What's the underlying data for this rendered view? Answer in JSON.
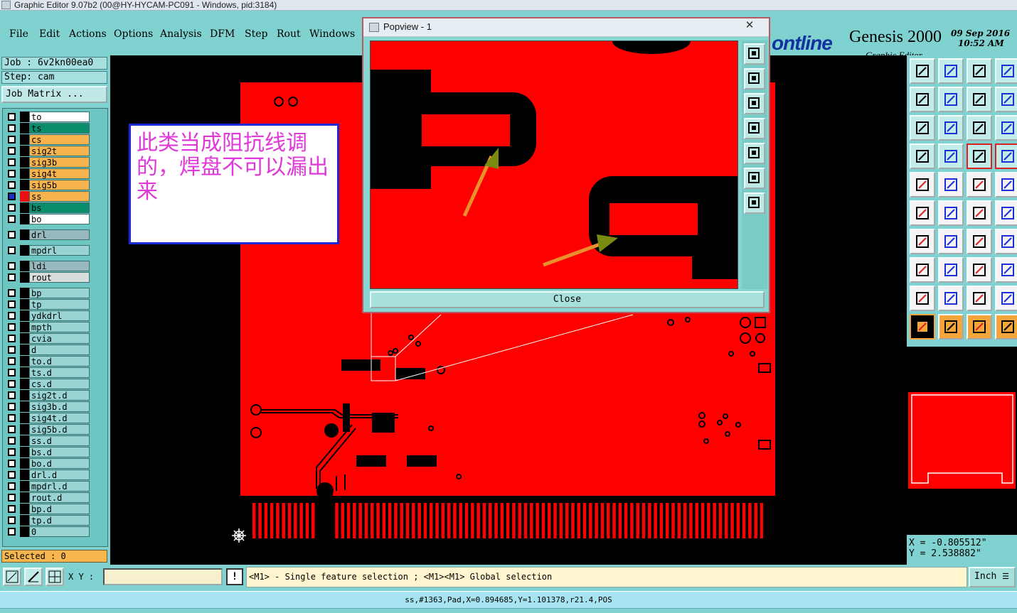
{
  "window": {
    "title": "Graphic Editor 9.07b2 (00@HY-HYCAM-PC091 - Windows, pid:3184)"
  },
  "menu": [
    {
      "label": "File"
    },
    {
      "label": "Edit"
    },
    {
      "label": "Actions"
    },
    {
      "label": "Options"
    },
    {
      "label": "Analysis"
    },
    {
      "label": "DFM"
    },
    {
      "label": "Step"
    },
    {
      "label": "Rout"
    },
    {
      "label": "Windows"
    }
  ],
  "brand": {
    "logo": "ontline",
    "product": "Genesis 2000",
    "subtitle": "Graphic Editor",
    "date_line1": "09 Sep 2016",
    "date_line2": "10:52 AM",
    "pause_glyph": "II"
  },
  "job": {
    "job_label": "Job : 6v2kn00ea0",
    "step_label": "Step: cam",
    "matrix_button": "Job Matrix ..."
  },
  "layers": [
    {
      "name": "to",
      "color": "#ffffff"
    },
    {
      "name": "ts",
      "color": "#0a8d6a"
    },
    {
      "name": "cs",
      "color": "#f6b34e"
    },
    {
      "name": "sig2t",
      "color": "#f6b34e"
    },
    {
      "name": "sig3b",
      "color": "#f6b34e"
    },
    {
      "name": "sig4t",
      "color": "#f6b34e"
    },
    {
      "name": "sig5b",
      "color": "#f6b34e"
    },
    {
      "name": "ss",
      "color": "#f6b34e",
      "active": true
    },
    {
      "name": "bs",
      "color": "#0a8d6a"
    },
    {
      "name": "bo",
      "color": "#ffffff"
    },
    {
      "name": "drl",
      "color": "#98b8bf"
    },
    {
      "name": "mpdrl",
      "color": "#98d4d4"
    },
    {
      "name": "ldi",
      "color": "#98b8bf"
    },
    {
      "name": "rout",
      "color": "#d8dede"
    },
    {
      "name": "bp",
      "color": "#98d4d4"
    },
    {
      "name": "tp",
      "color": "#98d4d4"
    },
    {
      "name": "ydkdrl",
      "color": "#98d4d4"
    },
    {
      "name": "mpth",
      "color": "#98d4d4"
    },
    {
      "name": "cvia",
      "color": "#98d4d4"
    },
    {
      "name": "d",
      "color": "#98d4d4"
    },
    {
      "name": "to.d",
      "color": "#98d4d4"
    },
    {
      "name": "ts.d",
      "color": "#98d4d4"
    },
    {
      "name": "cs.d",
      "color": "#98d4d4"
    },
    {
      "name": "sig2t.d",
      "color": "#98d4d4"
    },
    {
      "name": "sig3b.d",
      "color": "#98d4d4"
    },
    {
      "name": "sig4t.d",
      "color": "#98d4d4"
    },
    {
      "name": "sig5b.d",
      "color": "#98d4d4"
    },
    {
      "name": "ss.d",
      "color": "#98d4d4"
    },
    {
      "name": "bs.d",
      "color": "#98d4d4"
    },
    {
      "name": "bo.d",
      "color": "#98d4d4"
    },
    {
      "name": "drl.d",
      "color": "#98d4d4"
    },
    {
      "name": "mpdrl.d",
      "color": "#98d4d4"
    },
    {
      "name": "rout.d",
      "color": "#98d4d4"
    },
    {
      "name": "bp.d",
      "color": "#98d4d4"
    },
    {
      "name": "tp.d",
      "color": "#98d4d4"
    },
    {
      "name": "0",
      "color": "#98d4d4"
    }
  ],
  "selected_label": "Selected : 0",
  "annotation": {
    "text": "此类当成阻抗线调的，焊盘不可以漏出来"
  },
  "popview": {
    "title": "Popview - 1",
    "close_x": "✕",
    "close_button": "Close"
  },
  "coords": {
    "x": "X = -0.805512\"",
    "y": "Y = 2.538882\""
  },
  "command": {
    "xy_label": "X Y :",
    "xy_value": "",
    "excl": "!",
    "prompt": "<M1> - Single feature selection ; <M1><M1> Global selection",
    "units": "Inch"
  },
  "status": "ss,#1363,Pad,X=0.894685,Y=1.101378,r21.4,POS",
  "colors": {
    "board": "#ff0000",
    "background": "#000000",
    "ui_teal": "#7fd2cf",
    "arrow": "#e8912c"
  }
}
